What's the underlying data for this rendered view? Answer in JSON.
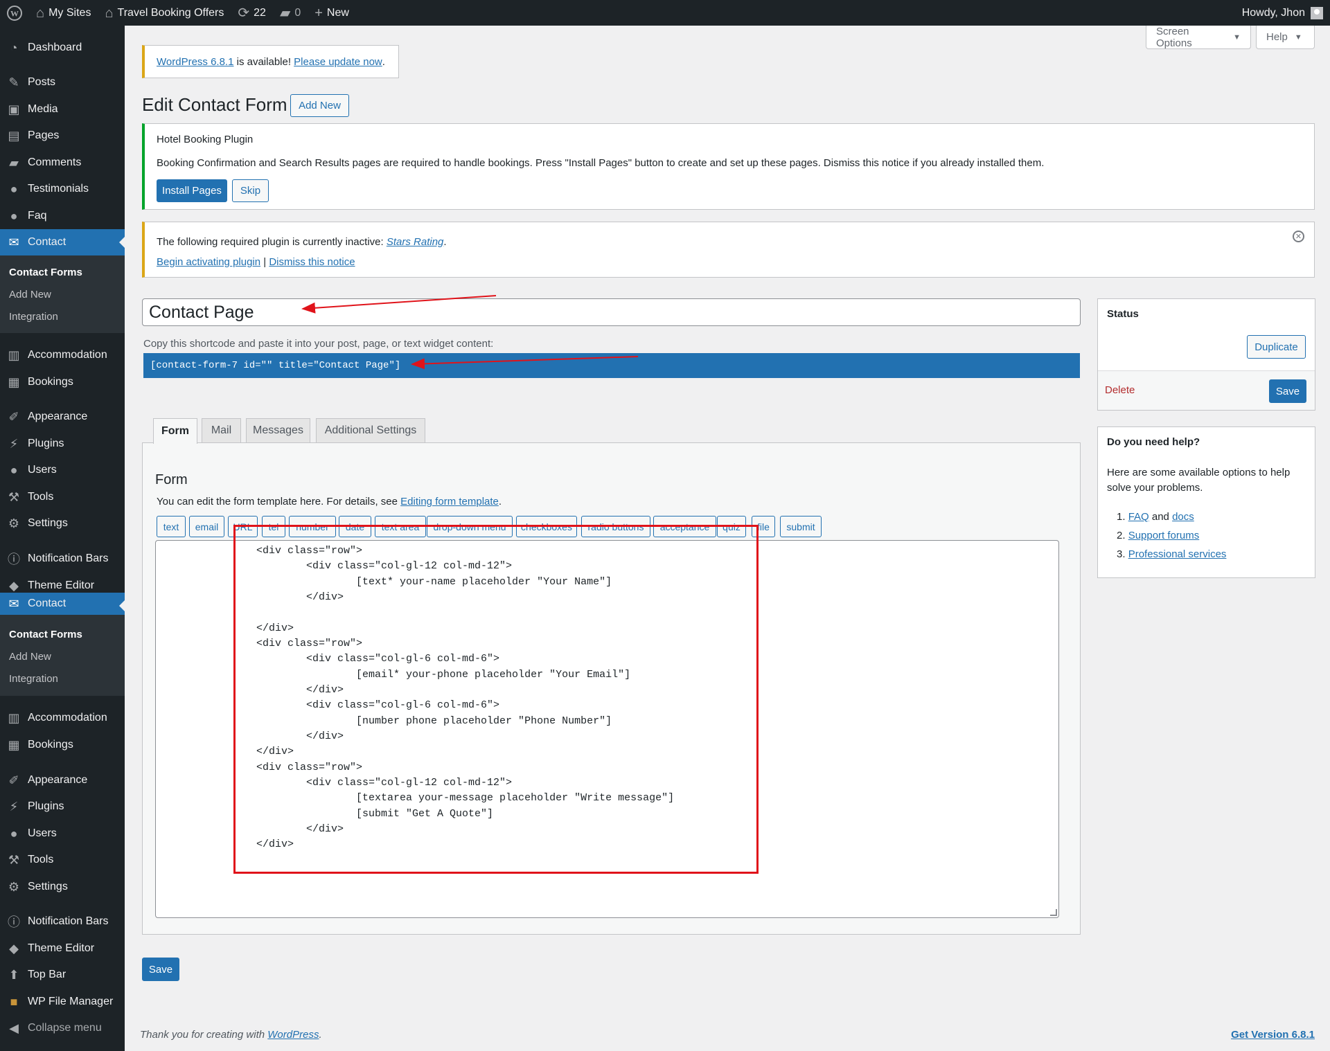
{
  "adminbar": {
    "my_sites": "My Sites",
    "site_name": "Travel Booking Offers",
    "updates_count": "22",
    "comments_count": "0",
    "new_label": "New",
    "howdy": "Howdy, Jhon"
  },
  "sidebar": {
    "dashboard": "Dashboard",
    "posts": "Posts",
    "media": "Media",
    "pages": "Pages",
    "comments": "Comments",
    "testimonials": "Testimonials",
    "faq": "Faq",
    "contact": "Contact",
    "contact_forms": "Contact Forms",
    "add_new": "Add New",
    "integration": "Integration",
    "accommodation": "Accommodation",
    "bookings": "Bookings",
    "appearance": "Appearance",
    "plugins": "Plugins",
    "users": "Users",
    "tools": "Tools",
    "settings": "Settings",
    "notification_bars": "Notification Bars",
    "theme_editor": "Theme Editor",
    "top_bar": "Top Bar",
    "wp_file_manager": "WP File Manager",
    "collapse": "Collapse menu"
  },
  "screen_options": "Screen Options",
  "help": "Help",
  "update_nag": {
    "version_link": "WordPress 6.8.1",
    "middle": " is available! ",
    "update_link": "Please update now",
    "end": "."
  },
  "page_title": "Edit Contact Form",
  "add_new_button": "Add New",
  "hotel_notice": {
    "title": "Hotel Booking Plugin",
    "text": "Booking Confirmation and Search Results pages are required to handle bookings. Press \"Install Pages\" button to create and set up these pages. Dismiss this notice if you already installed them.",
    "install": "Install Pages",
    "skip": "Skip"
  },
  "plugin_notice": {
    "text": "The following required plugin is currently inactive: ",
    "plugin": "Stars Rating",
    "period": ".",
    "begin": "Begin activating plugin",
    "separator": " | ",
    "dismiss": "Dismiss this notice"
  },
  "form_title_value": "Contact Page",
  "shortcode_label": "Copy this shortcode and paste it into your post, page, or text widget content:",
  "shortcode": "[contact-form-7 id=\"\" title=\"Contact Page\"]",
  "tabs": [
    "Form",
    "Mail",
    "Messages",
    "Additional Settings"
  ],
  "form_panel": {
    "heading": "Form",
    "desc_prefix": "You can edit the form template here. For details, see ",
    "desc_link": "Editing form template",
    "desc_suffix": "."
  },
  "tag_buttons": [
    "text",
    "email",
    "URL",
    "tel",
    "number",
    "date",
    "text area",
    "drop-down menu",
    "checkboxes",
    "radio buttons",
    "acceptance",
    "quiz",
    "file",
    "submit"
  ],
  "code_lines": [
    "<div class=\"row\">",
    "        <div class=\"col-gl-12 col-md-12\">",
    "                [text* your-name placeholder \"Your Name\"]",
    "        </div>",
    "",
    "</div>",
    "<div class=\"row\">",
    "        <div class=\"col-gl-6 col-md-6\">",
    "                [email* your-phone placeholder \"Your Email\"]",
    "        </div>",
    "        <div class=\"col-gl-6 col-md-6\">",
    "                [number phone placeholder \"Phone Number\"]",
    "        </div>",
    "</div>",
    "<div class=\"row\">",
    "        <div class=\"col-gl-12 col-md-12\">",
    "                [textarea your-message placeholder \"Write message\"]",
    "                [submit \"Get A Quote\"]",
    "        </div>",
    "</div>"
  ],
  "save_label": "Save",
  "status_box": {
    "title": "Status",
    "duplicate": "Duplicate",
    "delete": "Delete",
    "save": "Save"
  },
  "help_box": {
    "title": "Do you need help?",
    "text": "Here are some available options to help solve your problems.",
    "faq": "FAQ",
    "and": " and ",
    "docs": "docs",
    "support": "Support forums",
    "professional": "Professional services"
  },
  "footer": {
    "thanks_prefix": "Thank you for creating with ",
    "thanks_link": "WordPress",
    "thanks_suffix": ".",
    "version": "Get Version 6.8.1"
  },
  "colors": {
    "accent": "#2271b1",
    "sidebar_bg": "#1d2327",
    "annotation_red": "#e0131a",
    "notice_success": "#00a32a",
    "notice_warning": "#dba617",
    "delete_red": "#b32d2e"
  }
}
